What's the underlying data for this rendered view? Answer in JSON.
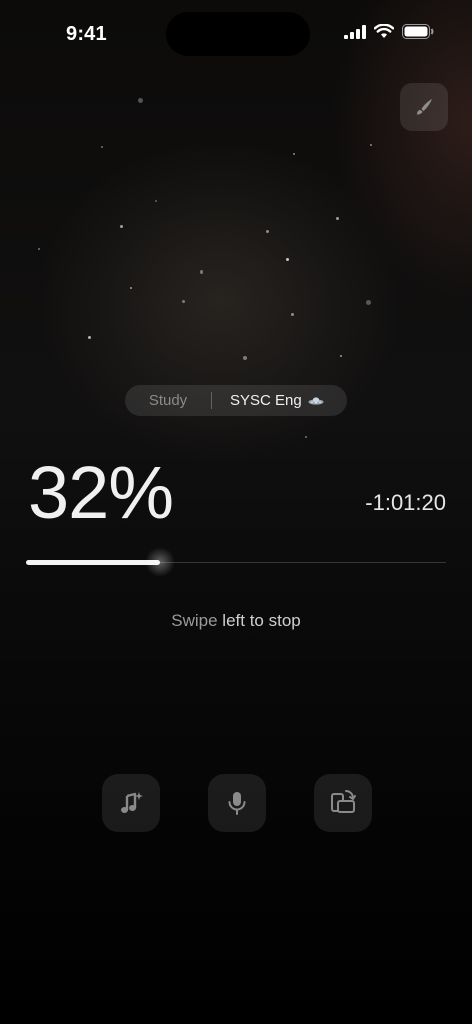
{
  "status_bar": {
    "time": "9:41"
  },
  "session": {
    "category": "Study",
    "task": "SYSC Eng",
    "task_icon": "ufo-icon"
  },
  "progress": {
    "percent_label": "32%",
    "fraction": 0.32,
    "remaining": "-1:01:20"
  },
  "hint": {
    "prefix": "Swipe ",
    "highlight": "left to stop"
  },
  "actions": [
    {
      "name": "music-sparkle-button",
      "icon": "music-note-sparkle-icon"
    },
    {
      "name": "microphone-button",
      "icon": "microphone-icon"
    },
    {
      "name": "rotate-screen-button",
      "icon": "screen-rotate-icon"
    }
  ],
  "theme": {
    "accent": "#f4f4f4",
    "background": "#000000"
  }
}
